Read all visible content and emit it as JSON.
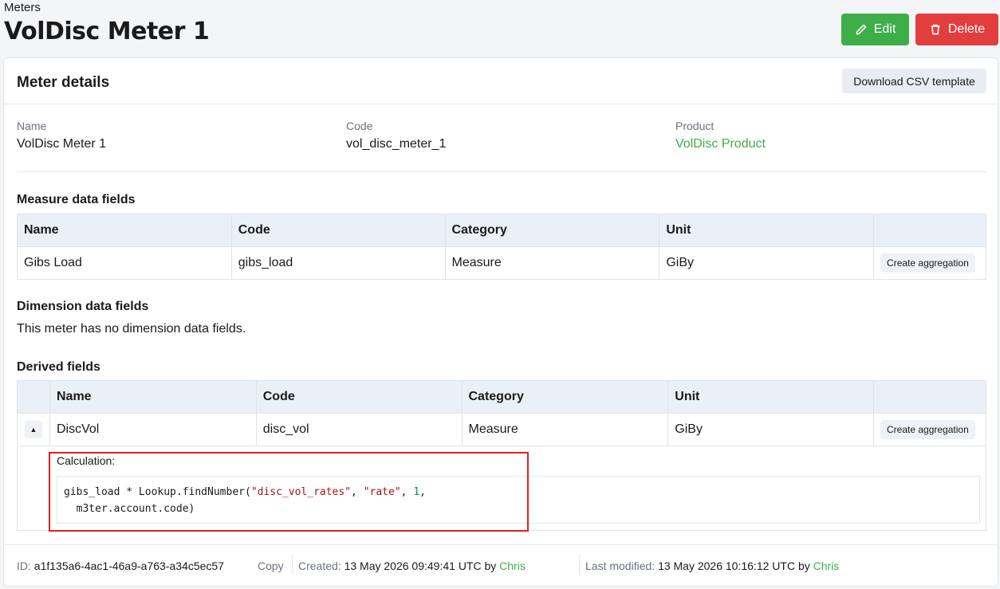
{
  "breadcrumb": "Meters",
  "page_title": "VolDisc Meter 1",
  "actions": {
    "edit": "Edit",
    "delete": "Delete"
  },
  "card": {
    "title": "Meter details",
    "csv_button": "Download CSV template",
    "details": [
      {
        "label": "Name",
        "value": "VolDisc Meter 1"
      },
      {
        "label": "Code",
        "value": "vol_disc_meter_1"
      },
      {
        "label": "Product",
        "value": "VolDisc Product"
      }
    ]
  },
  "measure": {
    "title": "Measure data fields",
    "headers": [
      "Name",
      "Code",
      "Category",
      "Unit"
    ],
    "rows": [
      {
        "name": "Gibs Load",
        "code": "gibs_load",
        "category": "Measure",
        "unit": "GiBy",
        "action": "Create aggregation"
      }
    ]
  },
  "dimension": {
    "title": "Dimension data fields",
    "empty_text": "This meter has no dimension data fields."
  },
  "derived": {
    "title": "Derived fields",
    "headers": [
      "Name",
      "Code",
      "Category",
      "Unit"
    ],
    "rows": [
      {
        "name": "DiscVol",
        "code": "disc_vol",
        "category": "Measure",
        "unit": "GiBy",
        "action": "Create aggregation"
      }
    ],
    "calc_label": "Calculation:",
    "calc": {
      "p1": "gibs_load * Lookup.findNumber(",
      "s1": "\"disc_vol_rates\"",
      "p2": ", ",
      "s2": "\"rate\"",
      "p3": ", ",
      "n1": "1",
      "p4": ",",
      "line2": "  m3ter.account.code)"
    }
  },
  "footer": {
    "id_label": "ID:",
    "id_value": "a1f135a6-4ac1-46a9-a763-a34c5ec57",
    "copy": "Copy",
    "created_label": "Created:",
    "created_value": "13 May 2026 09:49:41 UTC by",
    "created_by": "Chris",
    "modified_label": "Last modified:",
    "modified_value": "13 May 2026 10:16:12 UTC by",
    "modified_by": "Chris"
  },
  "colors": {
    "accent": "#3fae49",
    "danger": "#e23e3e",
    "highlight": "#e0201c"
  }
}
